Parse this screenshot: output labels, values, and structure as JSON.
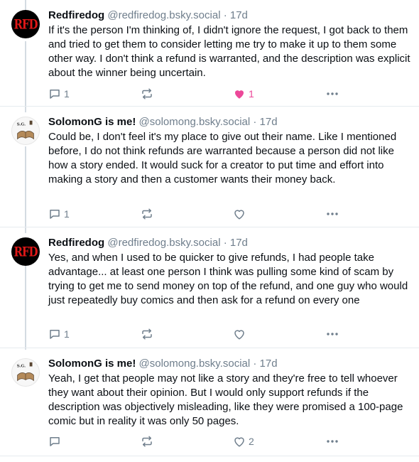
{
  "posts": [
    {
      "author": "Redfiredog",
      "handle": "@redfiredog.bsky.social",
      "time": "· 17d",
      "avatar": "rfd-avatar",
      "avatar_text": "RFD",
      "text": "If it's the person I'm thinking of, I didn't ignore the request, I got back to them and tried to get them to consider letting me try to make it up to them some other way. I don't think a refund is warranted, and the description was explicit about the winner being uncertain.",
      "reply_count": "1",
      "like_count": "1",
      "liked": true
    },
    {
      "author": "SolomonG is me!",
      "handle": "@solomong.bsky.social",
      "time": "· 17d",
      "avatar": "solomong-avatar",
      "avatar_text": "S.G.",
      "text": "Could be, I don't feel it's my place to give out their name. Like I mentioned before, I do not think refunds are warranted because a person did not like how a story ended. It would suck for a creator to put time and effort into making a story and then a customer wants their money back.",
      "reply_count": "1",
      "like_count": "",
      "liked": false
    },
    {
      "author": "Redfiredog",
      "handle": "@redfiredog.bsky.social",
      "time": "· 17d",
      "avatar": "rfd-avatar",
      "avatar_text": "RFD",
      "text": "Yes, and when I used to be quicker to give refunds, I had people take advantage... at least one person I think was pulling some kind of scam by trying to get me to send money on top of the refund, and one guy who would just repeatedly buy comics and then ask for a refund on every one",
      "reply_count": "1",
      "like_count": "",
      "liked": false
    },
    {
      "author": "SolomonG is me!",
      "handle": "@solomong.bsky.social",
      "time": "· 17d",
      "avatar": "solomong-avatar",
      "avatar_text": "S.G.",
      "text": "Yeah, I get that people may not like a story and they're free to tell whoever they want about their opinion. But I would only support refunds if the description was objectively misleading, like they were promised a 100-page comic but in reality it was only 50 pages.",
      "reply_count": "",
      "like_count": "2",
      "liked": false
    }
  ],
  "colors": {
    "muted": "#6f7e8c",
    "like_active": "#ec4899",
    "thread_line": "#d4dbe2",
    "rfd_red": "#e01717"
  }
}
